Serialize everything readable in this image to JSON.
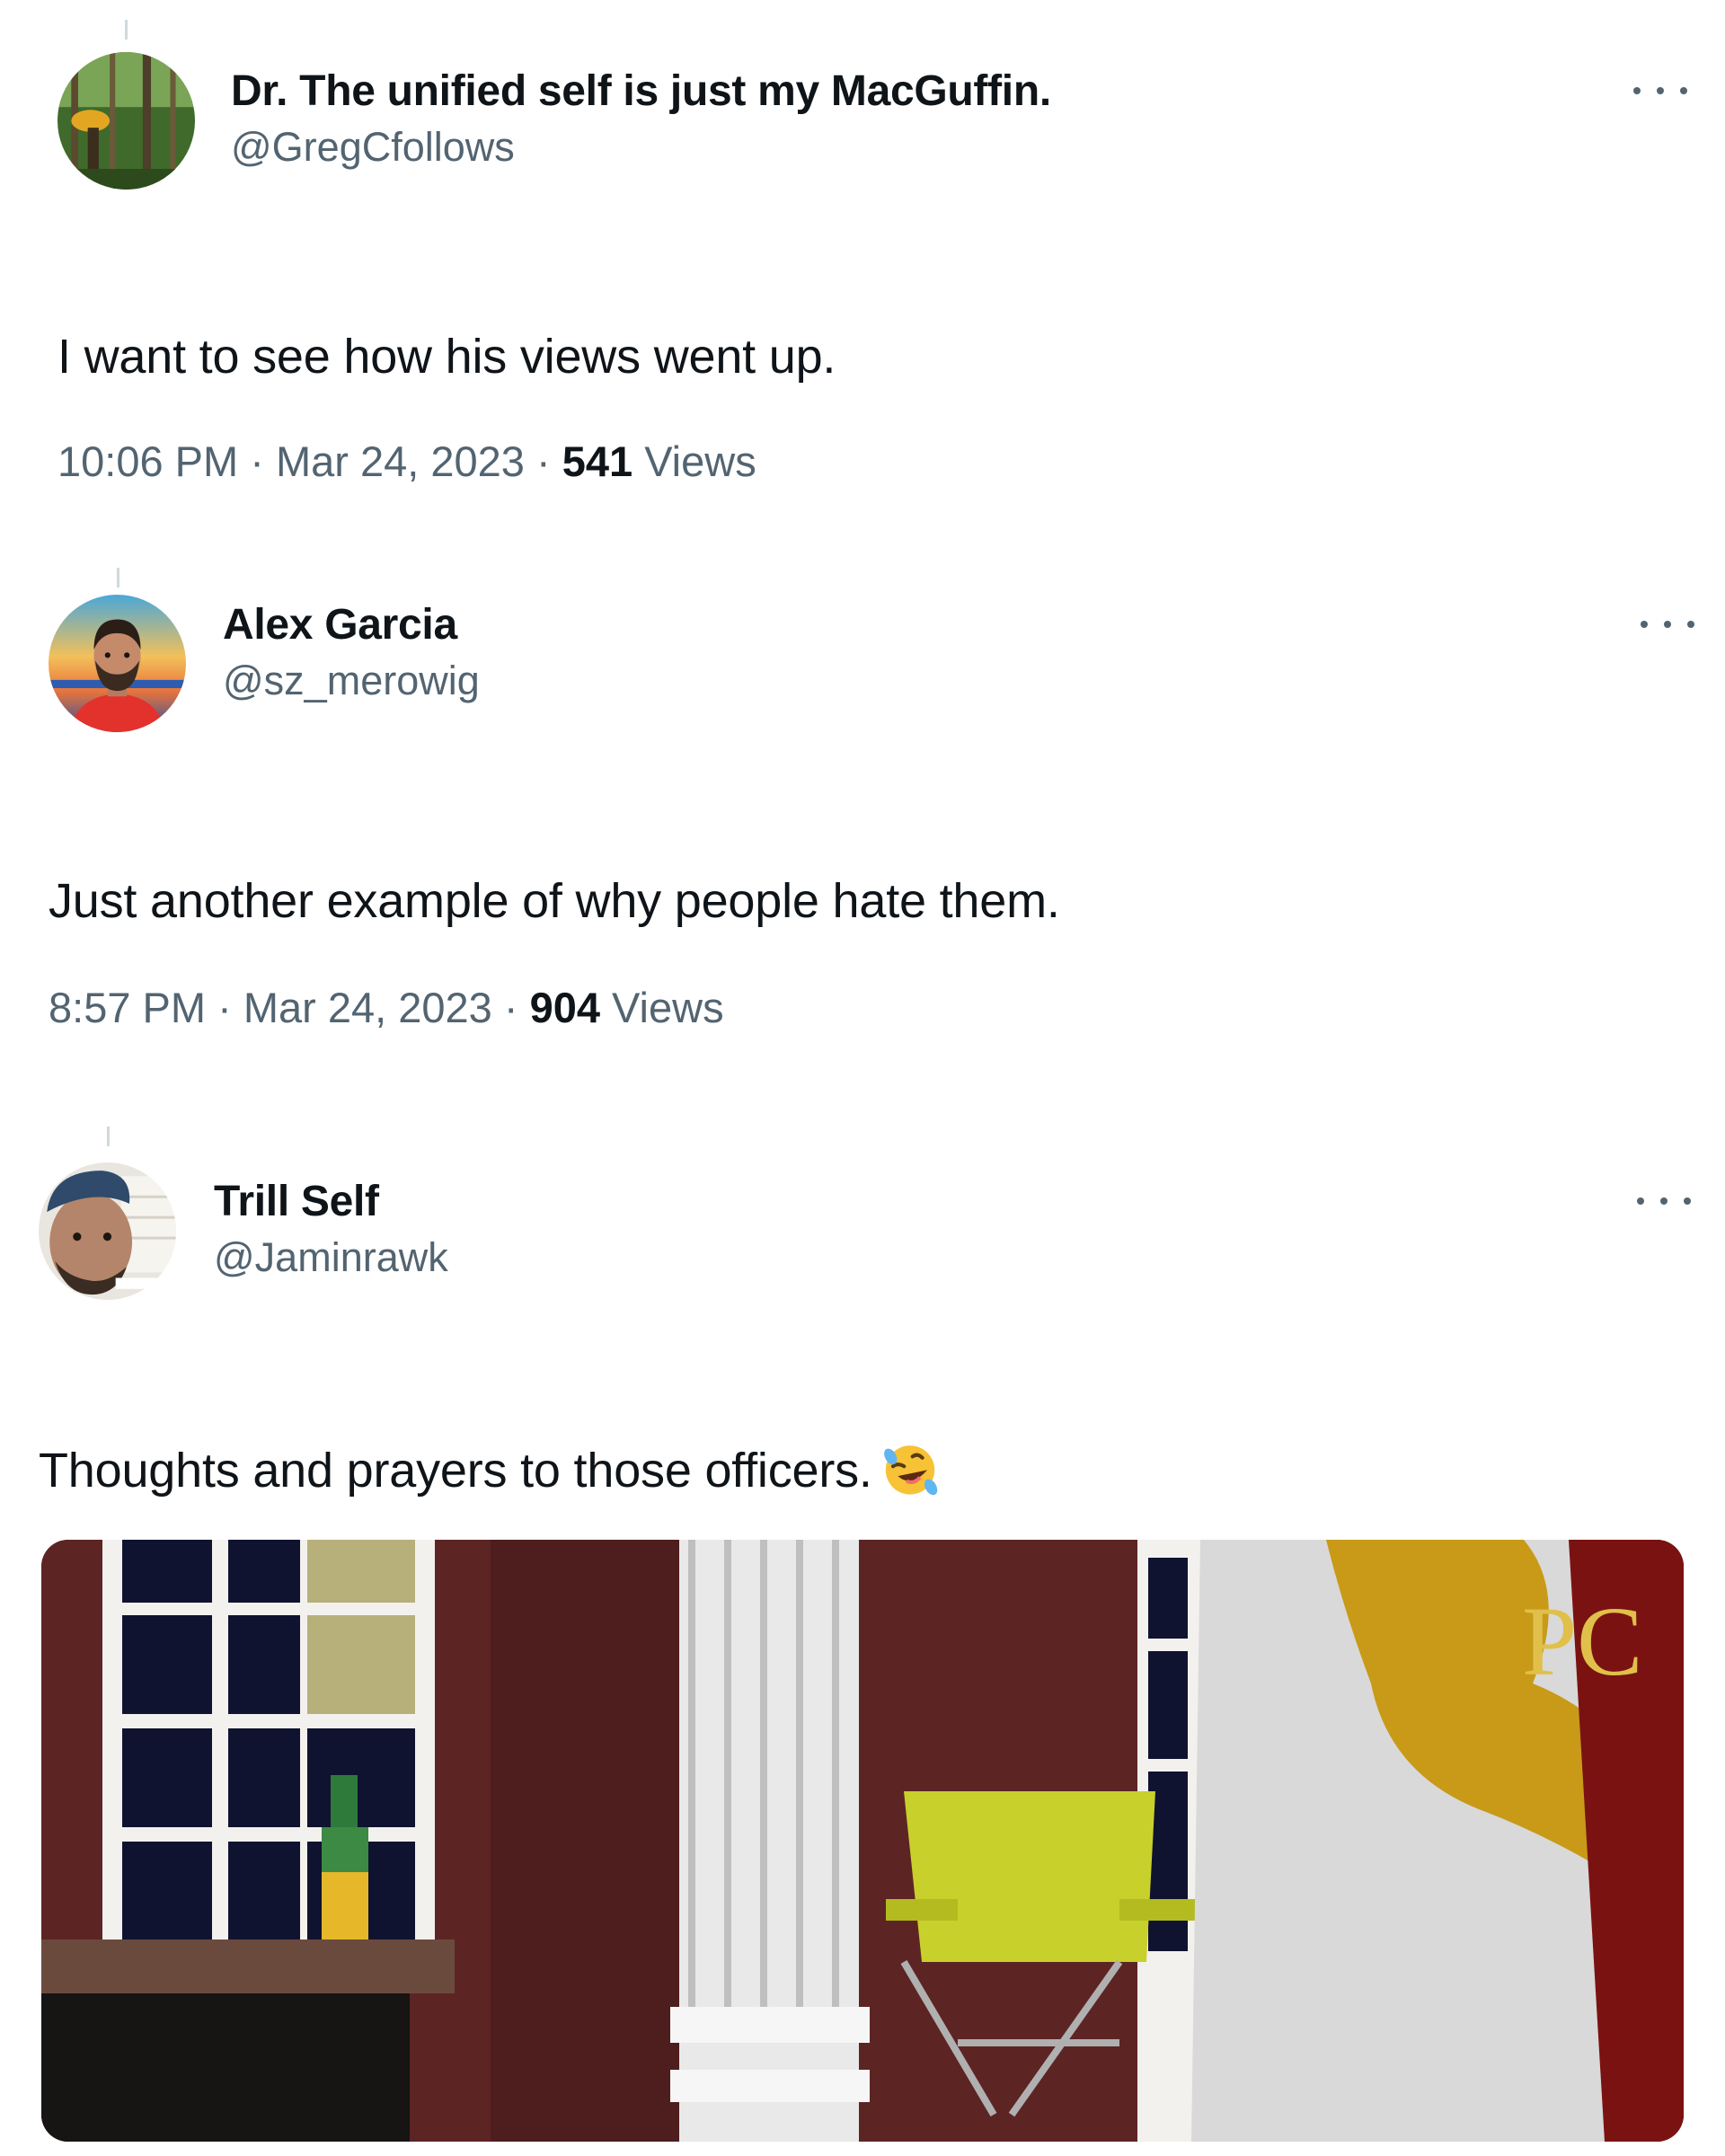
{
  "tweets": [
    {
      "display_name": "Dr. The unified self is just my MacGuffin.",
      "handle": "@GregCfollows",
      "text": "I want to see how his views went up.",
      "time": "10:06 PM",
      "separator": "·",
      "date": "Mar 24, 2023",
      "views_count": "541",
      "views_label": "Views",
      "avatar_icon": "forest-avatar",
      "more_icon": "more-options-icon"
    },
    {
      "display_name": "Alex Garcia",
      "handle": "@sz_merowig",
      "text": "Just another example of why people hate them.",
      "time": "8:57 PM",
      "separator": "·",
      "date": "Mar 24, 2023",
      "views_count": "904",
      "views_label": "Views",
      "avatar_icon": "bearded-man-avatar",
      "more_icon": "more-options-icon"
    },
    {
      "display_name": "Trill Self",
      "handle": "@Jaminrawk",
      "text": "Thoughts and prayers to those officers.",
      "emoji": "rolling-on-floor-laughing-emoji",
      "avatar_icon": "selfie-avatar",
      "more_icon": "more-options-icon",
      "media": {
        "type": "cartoon-video-frame",
        "sign_text": "PC"
      }
    }
  ],
  "colors": {
    "text_primary": "#0f1419",
    "text_secondary": "#536471",
    "thread_line": "#cfd9de",
    "background": "#ffffff"
  }
}
